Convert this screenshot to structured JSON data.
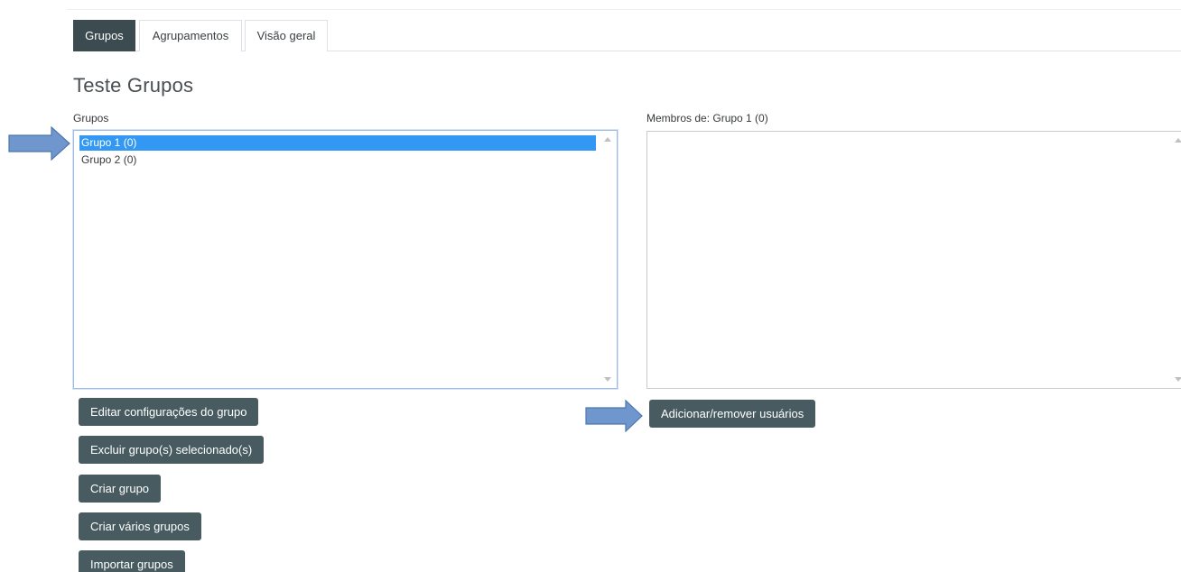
{
  "tabs": {
    "grupos": "Grupos",
    "agrupamentos": "Agrupamentos",
    "visao_geral": "Visão geral"
  },
  "page_title": "Teste Grupos",
  "groups": {
    "label": "Grupos",
    "options": [
      "Grupo 1 (0)",
      "Grupo 2 (0)"
    ],
    "selected_index": 0
  },
  "members": {
    "label": "Membros de: Grupo 1 (0)"
  },
  "buttons": {
    "edit": "Editar configurações do grupo",
    "delete": "Excluir grupo(s) selecionado(s)",
    "create": "Criar grupo",
    "create_many": "Criar vários grupos",
    "import": "Importar grupos",
    "add_remove": "Adicionar/remover usuários"
  },
  "colors": {
    "tab_active": "#3c4b50",
    "button": "#475b60",
    "selection": "#3298f3",
    "arrow_fill": "#6f97cd",
    "arrow_stroke": "#4d77ad"
  },
  "icons": {
    "pointer_arrow": "right-arrow-icon"
  }
}
